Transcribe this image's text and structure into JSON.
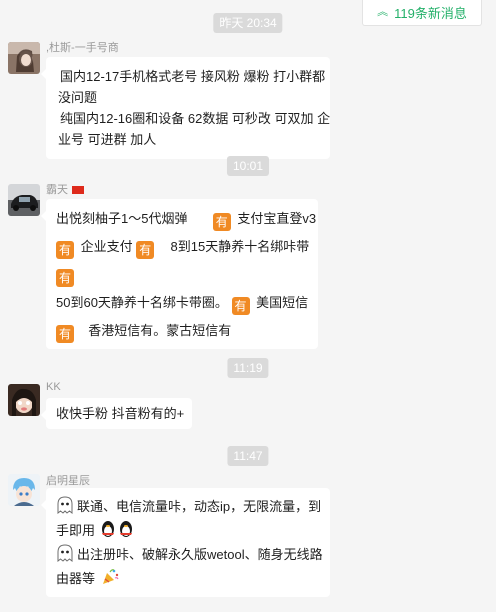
{
  "new_messages": {
    "label": "119条新消息",
    "icon": "chevron-up-double-icon"
  },
  "timestamps": [
    "昨天 20:34",
    "10:01",
    "11:19",
    "11:47"
  ],
  "messages": [
    {
      "sender": ",杜斯-一手号商",
      "lines": [
        "国内12-17手机格式老号 接风粉 爆粉 打小群都",
        "没问题",
        "纯国内12-16圈和设备 62数据 可秒改 可双加 企",
        "业号 可进群 加人"
      ]
    },
    {
      "sender": "霸天",
      "badge_text": "有",
      "lines": [
        "出悦刻柚子1～5代烟弹",
        "支付宝直登v3",
        "企业支付",
        "8到15天静养十名绑咔带",
        "50到60天静养十名绑卡带圈。",
        "美国短信",
        "香港短信有。蒙古短信有"
      ]
    },
    {
      "sender": "KK",
      "lines": [
        "收快手粉  抖音粉有的+"
      ]
    },
    {
      "sender": "启明星辰",
      "lines": [
        "联通、电信流量咔，动态ip，无限流量，到",
        "手即用",
        "出注册咔、破解永久版wetool、随身无线路",
        "由器等"
      ]
    }
  ],
  "colors": {
    "background": "#f5f5f5",
    "bubble": "#ffffff",
    "accent_green": "#23b069",
    "badge_orange": "#f08a24",
    "time_pill": "#dadada"
  }
}
